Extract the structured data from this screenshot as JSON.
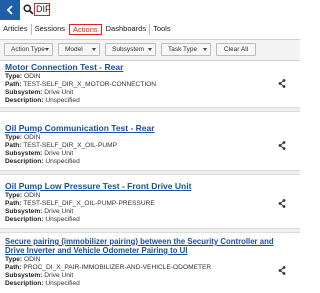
{
  "search": {
    "value": "DIF"
  },
  "tabs": [
    {
      "label": "Articles",
      "active": false
    },
    {
      "label": "Sessions",
      "active": false
    },
    {
      "label": "Actions",
      "active": true
    },
    {
      "label": "Dashboards",
      "active": false
    },
    {
      "label": "Tools",
      "active": false
    }
  ],
  "filters": {
    "action_type": "Action Type",
    "model": "Model",
    "subsystem": "Subsystem",
    "task_type": "Task Type",
    "clear_all": "Clear All"
  },
  "field_labels": {
    "type": "Type:",
    "path": "Path:",
    "subsystem": "Subsystem:",
    "description": "Description:"
  },
  "results": [
    {
      "title": "Motor Connection Test - Rear",
      "type": "ODIN",
      "path": "TEST-SELF_DIR_X_MOTOR-CONNECTION",
      "subsystem": "Drive Unit",
      "description": "Unspecified"
    },
    {
      "title": "Oil Pump Communication Test - Rear",
      "type": "ODIN",
      "path": "TEST-SELF_DIR_X_OIL-PUMP",
      "subsystem": "Drive Unit",
      "description": "Unspecified"
    },
    {
      "title": "Oil Pump Low Pressure Test - Front Drive Unit",
      "type": "ODIN",
      "path": "TEST-SELF_DIF_X_OIL-PUMP-PRESSURE",
      "subsystem": "Drive Unit",
      "description": "Unspecified"
    },
    {
      "title_line1": "Secure pairing (immobilizer pairing) between the Security Controller and",
      "title_line2": "Drive Inverter and Vehicle Odometer Pairing to UI",
      "type": "ODIN",
      "path": "PROC_DI_X_PAIR-IMMOBILIZER-AND-VEHICLE-ODOMETER",
      "subsystem": "Drive Unit",
      "description": "Unspecified"
    }
  ],
  "icons": {
    "back": "chevron-left-icon",
    "search": "search-icon",
    "share": "share-icon"
  },
  "colors": {
    "back_button": "#1e5fa8",
    "accent_red": "#d9261c",
    "link_blue": "#1a4fa3"
  }
}
